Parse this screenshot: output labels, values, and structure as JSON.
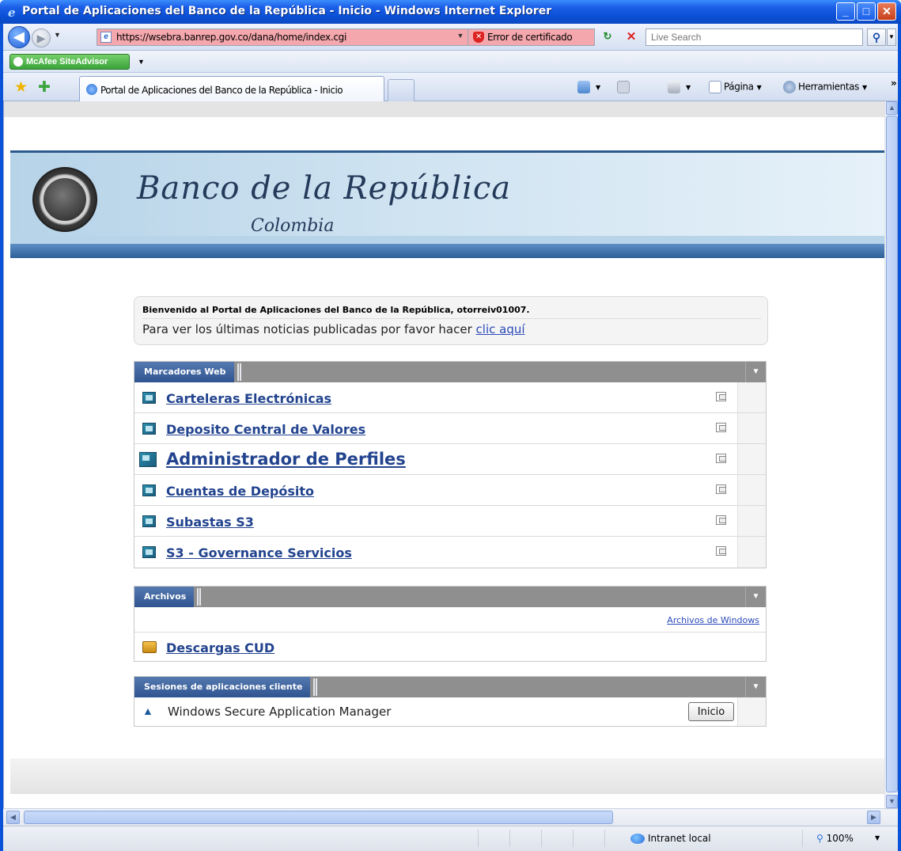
{
  "window": {
    "title": "Portal de Aplicaciones del Banco de la República - Inicio - Windows Internet Explorer"
  },
  "address_bar": {
    "url": "https://wsebra.banrep.gov.co/dana/home/index.cgi",
    "cert_error": "Error de certificado",
    "search_placeholder": "Live Search"
  },
  "toolbar": {
    "mcafee_label": "McAfee SiteAdvisor"
  },
  "tabs": [
    {
      "label": "Portal de Aplicaciones del Banco de la República - Inicio"
    }
  ],
  "command_bar": {
    "page_label": "Página",
    "tools_label": "Herramientas",
    "more": "»"
  },
  "banner": {
    "title": "Banco de la República",
    "subtitle": "Colombia"
  },
  "welcome": {
    "line1": "Bienvenido al Portal de Aplicaciones del Banco de la República, otorreiv01007.",
    "line2_prefix": "Para ver los últimas noticias publicadas por favor hacer ",
    "line2_link": "clic aquí"
  },
  "panels": {
    "bookmarks": {
      "title": "Marcadores Web",
      "items": [
        {
          "label": "Carteleras Electrónicas"
        },
        {
          "label": "Deposito Central de Valores "
        },
        {
          "label": "Administrador de Perfiles"
        },
        {
          "label": "Cuentas de Depósito"
        },
        {
          "label": "Subastas S3"
        },
        {
          "label": "S3 - Governance Servicios"
        }
      ]
    },
    "files": {
      "title": "Archivos",
      "windows_files_link": "Archivos de Windows",
      "items": [
        {
          "label": "Descargas CUD"
        }
      ]
    },
    "client_sessions": {
      "title": "Sesiones de aplicaciones cliente",
      "items": [
        {
          "label": "Windows Secure Application Manager",
          "button": "Inicio"
        }
      ]
    }
  },
  "status_bar": {
    "zone": "Intranet local",
    "zoom": "100%"
  },
  "colors": {
    "titlebar": "#0a4fd4",
    "panel_header": "#2f5490",
    "link": "#22438e",
    "cert_error_bg": "#f4a7ad"
  }
}
